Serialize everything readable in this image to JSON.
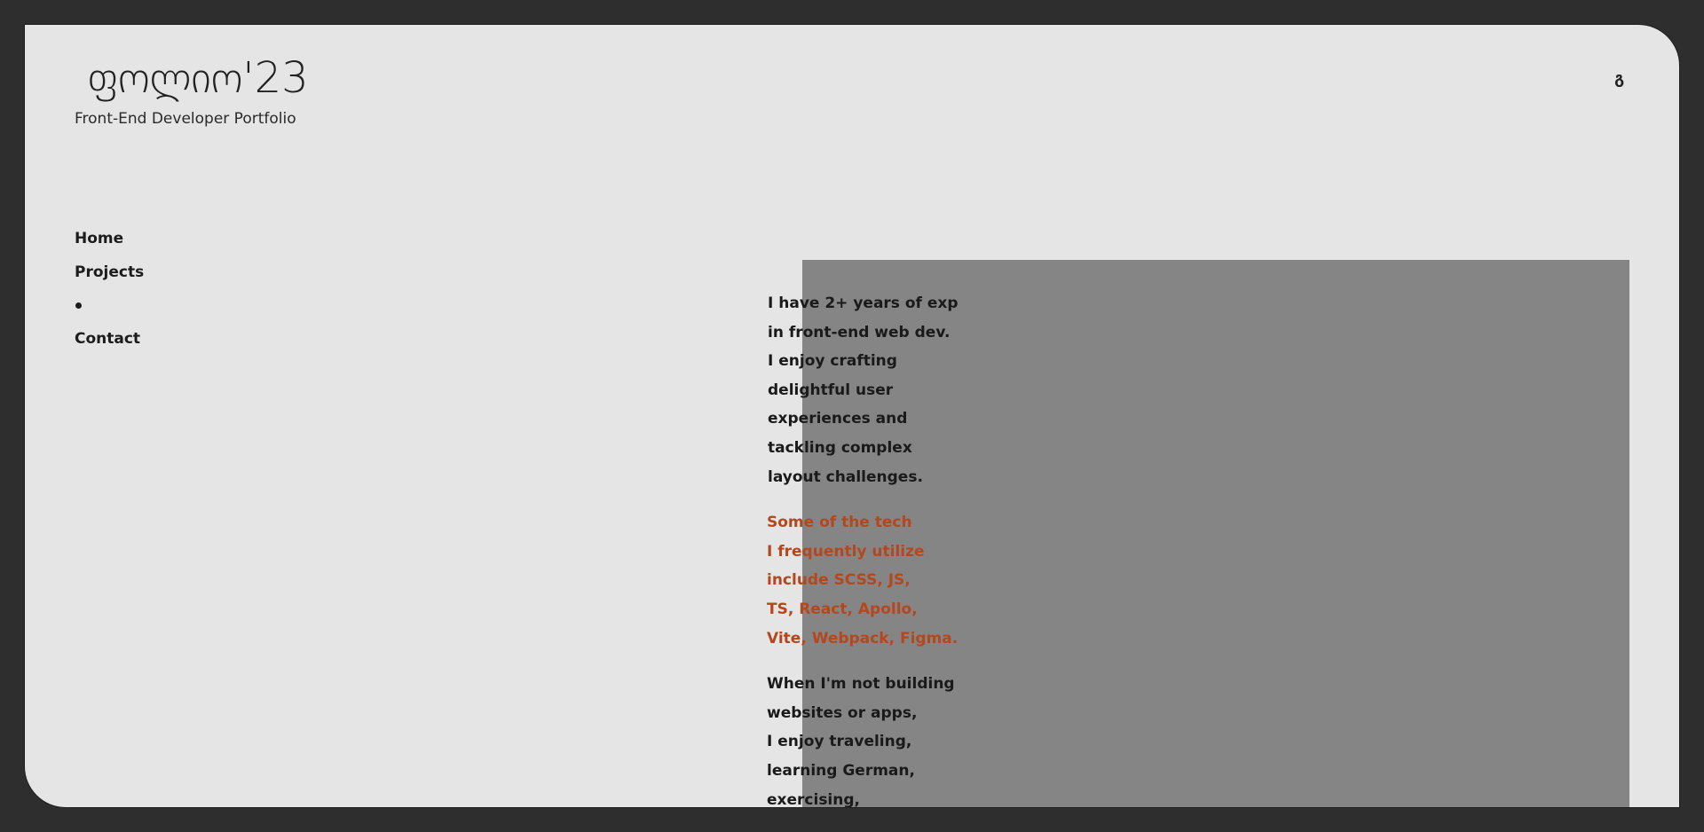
{
  "header": {
    "logo_text": "ფოლიო'23",
    "subtitle": "Front-End Developer Portfolio",
    "language_toggle": "გ"
  },
  "nav": {
    "items": [
      {
        "label": "Home"
      },
      {
        "label": "Projects"
      },
      {
        "label": ""
      },
      {
        "label": "Contact"
      }
    ]
  },
  "about": {
    "intro_lines": [
      "I have 2+ years of exp",
      "in front-end web dev.",
      "I enjoy crafting",
      "delightful user",
      "experiences and",
      "tackling complex",
      "layout challenges."
    ],
    "tech_lines": [
      "Some of the tech",
      "I frequently utilize",
      "include SCSS, JS,",
      "TS, React, Apollo,",
      "Vite, Webpack, Figma."
    ],
    "hobby_lines": [
      "When I'm not building",
      "websites or apps,",
      "I enjoy traveling,",
      "learning German,",
      "exercising,"
    ]
  },
  "colors": {
    "background": "#e5e5e5",
    "frame_border": "#2e2e2e",
    "panel": "#858585",
    "accent": "#b5471c",
    "text": "#1a1a1a"
  }
}
